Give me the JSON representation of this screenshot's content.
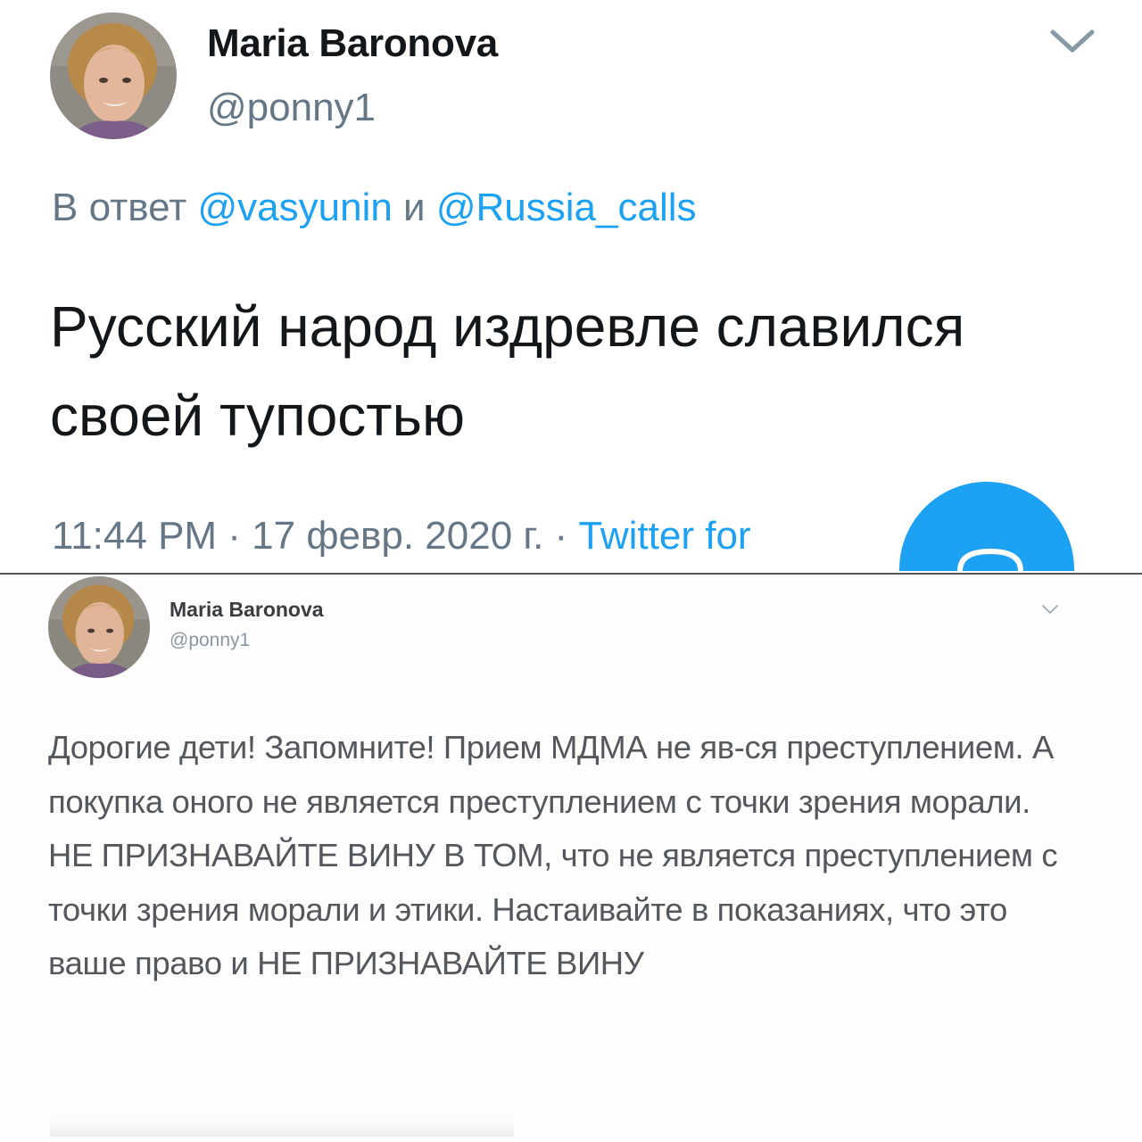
{
  "top_tweet": {
    "author_name": "Maria Baronova",
    "author_handle": "@ponny1",
    "reply_prefix": "В ответ ",
    "reply_to_1": "@vasyunin",
    "reply_joiner": " и ",
    "reply_to_2": "@Russia_calls",
    "text": "Русский народ издревле славился своей тупостью",
    "timestamp": "11:44 PM · 17 февр. 2020 г. · ",
    "source": "Twitter for"
  },
  "bottom_tweet": {
    "author_name": "Maria Baronova",
    "author_handle": "@ponny1",
    "text": "Дорогие дети! Запомните! Прием МДМА не яв-ся преступлением. А покупка оного не является преступлением с точки зрения морали. НЕ ПРИЗНАВАЙТЕ ВИНУ В ТОМ, что не является преступлением с точки зрения морали и этики. Настаивайте в показаниях, что это ваше право и НЕ ПРИЗНАВАЙТЕ ВИНУ"
  },
  "colors": {
    "accent": "#1da1f2",
    "text_primary": "#14171a",
    "text_secondary": "#657786"
  },
  "icons": {
    "menu": "chevron-down-icon",
    "compose": "compose-tweet-icon"
  }
}
